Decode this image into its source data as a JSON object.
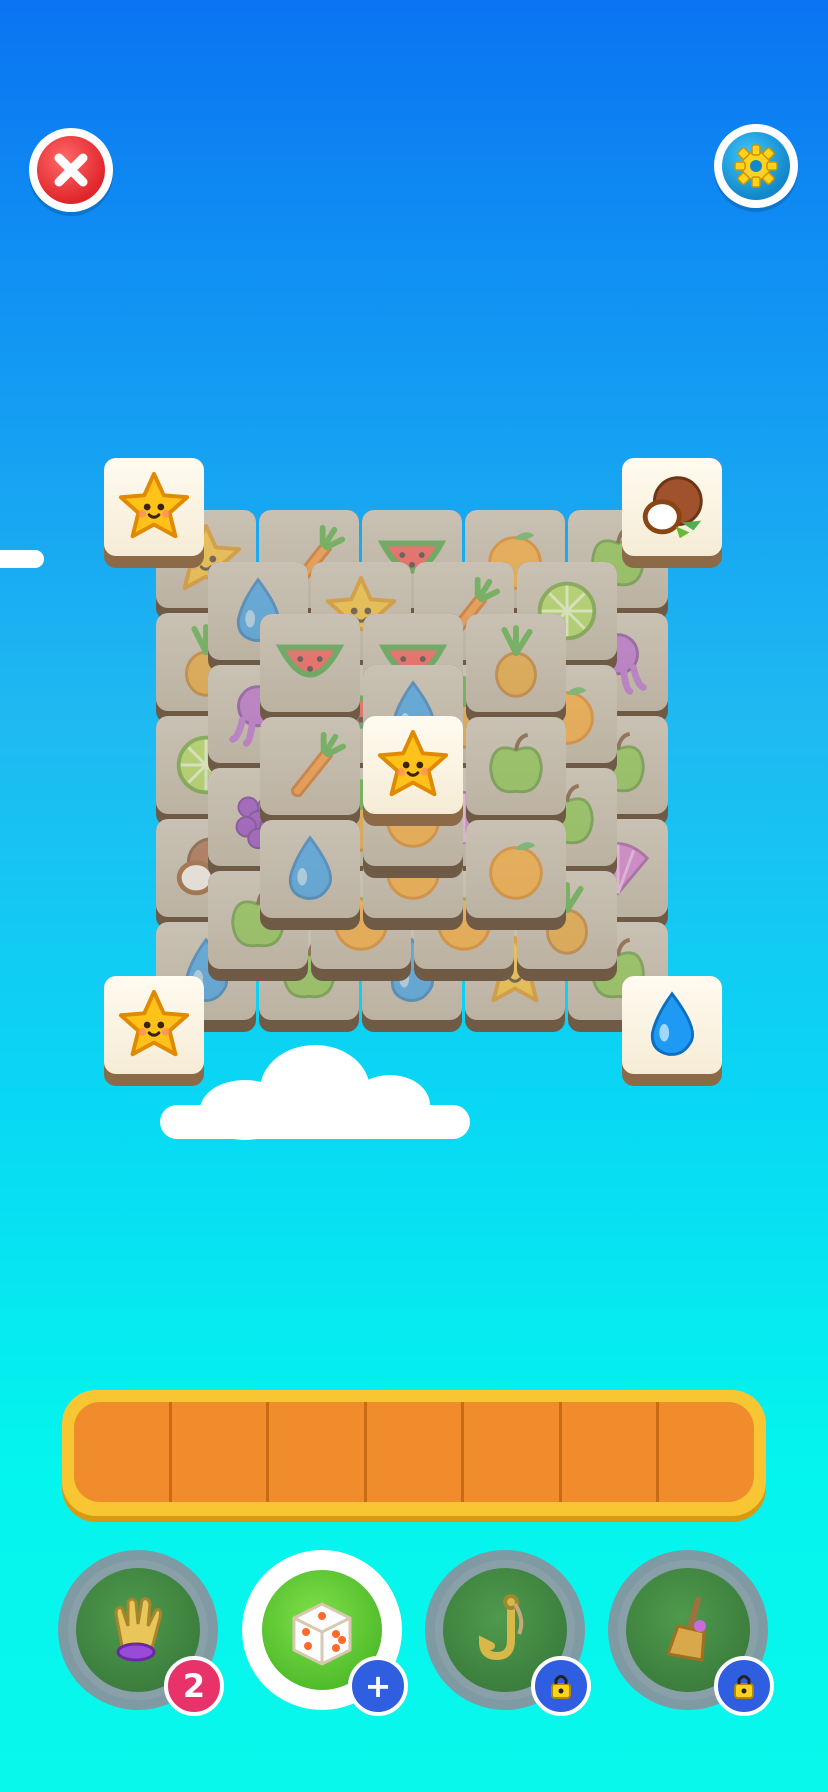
{
  "top_bar": {
    "close_icon": "close-icon",
    "settings_icon": "gear-icon"
  },
  "board": {
    "tiles": [
      {
        "icon": "star",
        "layer": "base",
        "dim": true
      },
      {
        "icon": "carrot",
        "layer": "base",
        "dim": true
      },
      {
        "icon": "watermelon",
        "layer": "base",
        "dim": true
      },
      {
        "icon": "orange",
        "layer": "base",
        "dim": true
      },
      {
        "icon": "apple",
        "layer": "base",
        "dim": true
      }
    ],
    "free_tiles": [
      {
        "icon": "star",
        "position": "top-left"
      },
      {
        "icon": "coconut",
        "position": "top-right"
      },
      {
        "icon": "star",
        "position": "center"
      },
      {
        "icon": "water-drop",
        "position": "bottom-left-star"
      },
      {
        "icon": "water-drop",
        "position": "bottom-right"
      }
    ]
  },
  "tray": {
    "slots": 7,
    "filled": 0
  },
  "boosters": [
    {
      "name": "glove",
      "icon": "glove-icon",
      "badge": "2",
      "badge_color": "#e8336a",
      "locked": false
    },
    {
      "name": "dice",
      "icon": "dice-icon",
      "badge": "+",
      "badge_color": "#2f5fe0",
      "locked": false,
      "active": true
    },
    {
      "name": "hook",
      "icon": "hook-icon",
      "badge": "",
      "badge_color": "#2f5fe0",
      "locked": true
    },
    {
      "name": "broom",
      "icon": "broom-icon",
      "badge": "",
      "badge_color": "#2f5fe0",
      "locked": true
    }
  ],
  "colors": {
    "sky_top": "#0a74f2",
    "sky_bottom": "#08f8ec",
    "tray_border": "#f7c632",
    "tray_fill": "#f18c2c"
  }
}
